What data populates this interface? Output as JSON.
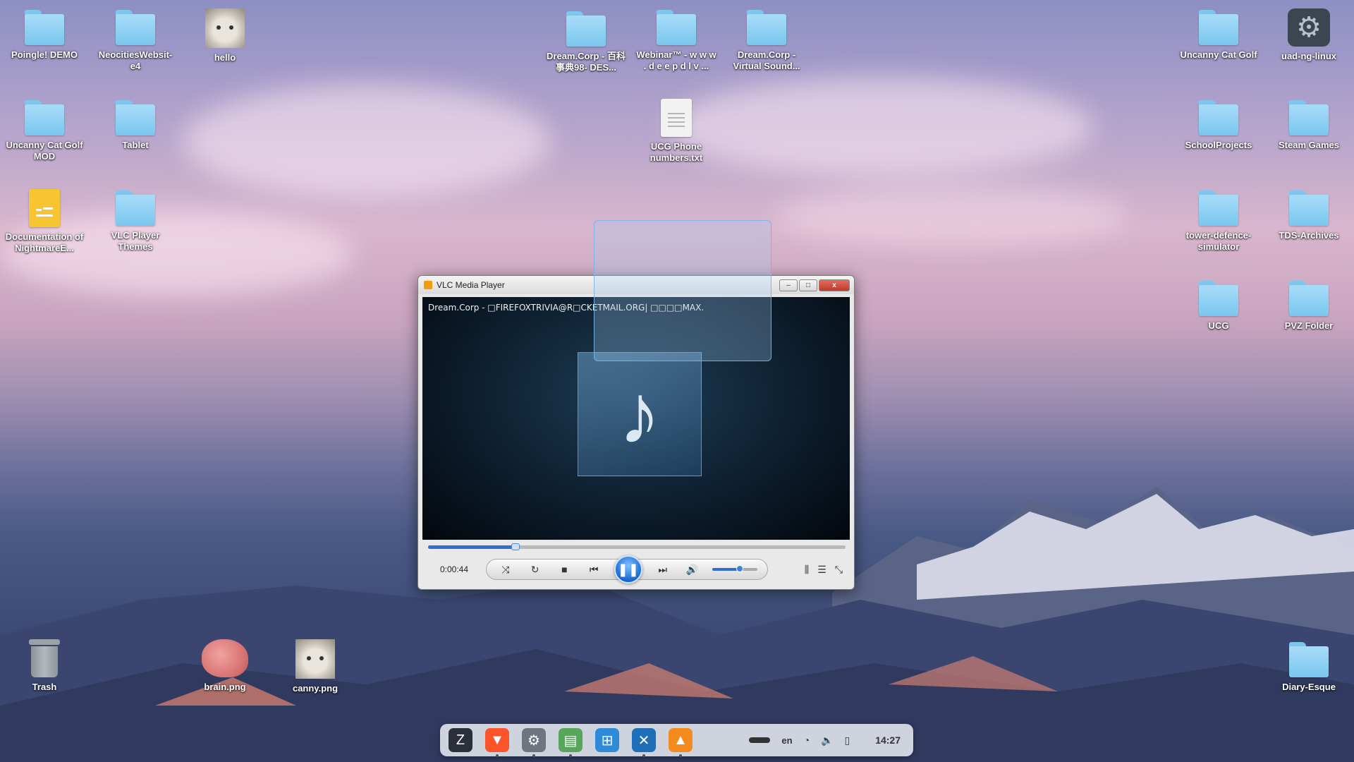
{
  "desktop": {
    "icons_left": [
      {
        "label": "Poingle! DEMO",
        "type": "folder"
      },
      {
        "label": "NeocitiesWebsit-e4",
        "type": "folder"
      },
      {
        "label": "hello",
        "type": "image"
      },
      {
        "label": "Uncanny Cat Golf MOD",
        "type": "folder"
      },
      {
        "label": "Tablet",
        "type": "folder"
      },
      {
        "label": "Documentation of NightmareE...",
        "type": "document"
      },
      {
        "label": "VLC Player Themes",
        "type": "folder"
      }
    ],
    "icons_center": [
      {
        "label": "Dream.Corp - 百科事典98- DES...",
        "type": "folder"
      },
      {
        "label": "Webinar™ - w w w . d e e p d l v ...",
        "type": "folder"
      },
      {
        "label": "Dream.Corp - Virtual Sound...",
        "type": "folder"
      },
      {
        "label": "UCG Phone numbers.txt",
        "type": "text-file"
      }
    ],
    "icons_right": [
      {
        "label": "Uncanny Cat Golf",
        "type": "folder"
      },
      {
        "label": "uad-ng-linux",
        "type": "app"
      },
      {
        "label": "SchoolProjects",
        "type": "folder"
      },
      {
        "label": "Steam Games",
        "type": "folder"
      },
      {
        "label": "tower-defence-simulator",
        "type": "folder"
      },
      {
        "label": "TDS-Archives",
        "type": "folder"
      },
      {
        "label": "UCG",
        "type": "folder"
      },
      {
        "label": "PVZ Folder",
        "type": "folder"
      },
      {
        "label": "Diary-Esque",
        "type": "folder"
      }
    ],
    "icons_bottom": [
      {
        "label": "Trash",
        "type": "trash"
      },
      {
        "label": "brain.png",
        "type": "image"
      },
      {
        "label": "canny.png",
        "type": "image"
      }
    ]
  },
  "vlc": {
    "window_title": "VLC Media Player",
    "media_title": "Dream.Corp - □FIREFOXTRIVIA@R□CKETMAIL.ORG| □□□□MAX.",
    "elapsed": "0:00:44",
    "progress_fraction": 0.21,
    "volume_fraction": 0.6,
    "buttons": {
      "minimize": "–",
      "maximize": "□",
      "close": "x"
    },
    "icons": {
      "album_art": "music-note-icon",
      "shuffle": "shuffle-icon",
      "loop": "loop-icon",
      "stop": "stop-icon",
      "prev": "previous-icon",
      "play_pause": "pause-icon",
      "next": "next-icon",
      "volume": "volume-icon",
      "equalizer": "equalizer-icon",
      "playlist": "playlist-icon",
      "fullscreen": "fullscreen-icon"
    }
  },
  "taskbar": {
    "apps": [
      {
        "name": "zorin-menu-icon",
        "color": "#2b2f3a"
      },
      {
        "name": "brave-browser-icon",
        "color": "#fb542b"
      },
      {
        "name": "settings-icon",
        "color": "#6d7680"
      },
      {
        "name": "files-icon",
        "color": "#58a55c"
      },
      {
        "name": "software-store-icon",
        "color": "#2f8ad8"
      },
      {
        "name": "vscode-icon",
        "color": "#1e6fb8"
      },
      {
        "name": "vlc-icon",
        "color": "#f58b1f"
      }
    ],
    "language": "en",
    "clock": "14:27"
  }
}
